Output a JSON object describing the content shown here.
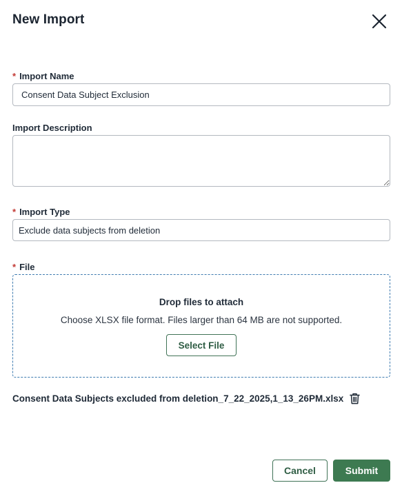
{
  "dialog": {
    "title": "New Import",
    "close_icon": "close-icon"
  },
  "form": {
    "required_marker": "*",
    "import_name": {
      "label": "Import Name",
      "value": "Consent Data Subject Exclusion",
      "required": true
    },
    "import_description": {
      "label": "Import Description",
      "value": "",
      "required": false
    },
    "import_type": {
      "label": "Import Type",
      "value": "Exclude data subjects from deletion",
      "required": true
    },
    "file": {
      "label": "File",
      "required": true,
      "dropzone_title": "Drop files to attach",
      "dropzone_hint": "Choose XLSX file format. Files larger than 64 MB are not supported.",
      "select_button_label": "Select File",
      "attached_file_name": "Consent Data Subjects excluded from deletion_7_22_2025,1_13_26PM.xlsx",
      "delete_icon": "trash-icon"
    }
  },
  "footer": {
    "cancel_label": "Cancel",
    "submit_label": "Submit"
  },
  "colors": {
    "primary_green": "#3d7a51",
    "required_red": "#c23934",
    "dropzone_border": "#3e7bb0"
  }
}
